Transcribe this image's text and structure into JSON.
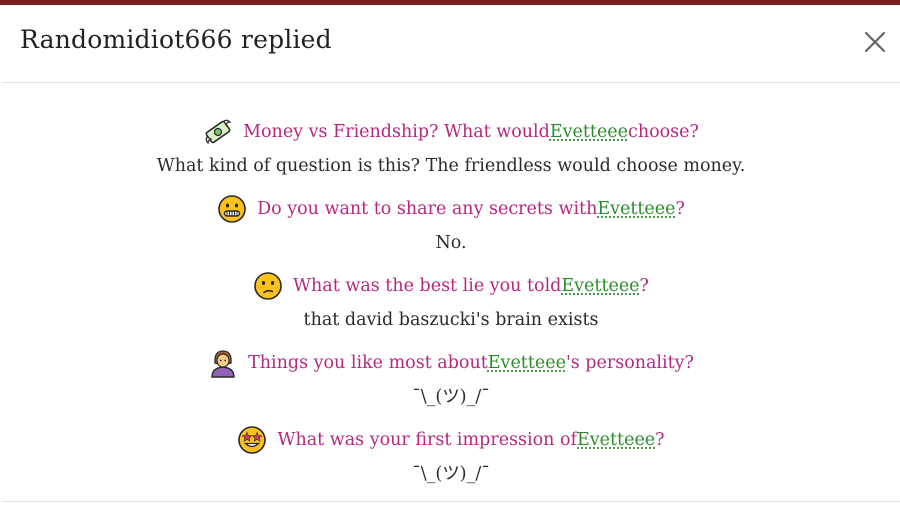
{
  "modal": {
    "title": "Randomidiot666 replied",
    "close_icon": "close-icon"
  },
  "colors": {
    "question": "#b5287f",
    "mention": "#2e8b2e",
    "answer": "#2b2b2b",
    "top_bar": "#7a1f1f"
  },
  "qa": [
    {
      "icon": "money-with-wings-icon",
      "q_before": "Money vs Friendship? What would ",
      "mention": "Evetteee",
      "q_after": " choose?",
      "answer": "What kind of question is this? The friendless would choose money."
    },
    {
      "icon": "zipper-mouth-face-icon",
      "q_before": "Do you want to share any secrets with ",
      "mention": "Evetteee",
      "q_after": "?",
      "answer": "No."
    },
    {
      "icon": "confused-face-icon",
      "q_before": "What was the best lie you told ",
      "mention": "Evetteee",
      "q_after": "?",
      "answer": "that david baszucki's brain exists"
    },
    {
      "icon": "person-icon",
      "q_before": "Things you like most about ",
      "mention": "Evetteee",
      "q_after": "'s personality?",
      "answer": "¯\\_(ツ)_/¯"
    },
    {
      "icon": "star-struck-face-icon",
      "q_before": "What was your first impression of ",
      "mention": "Evetteee",
      "q_after": "?",
      "answer": "¯\\_(ツ)_/¯"
    }
  ]
}
